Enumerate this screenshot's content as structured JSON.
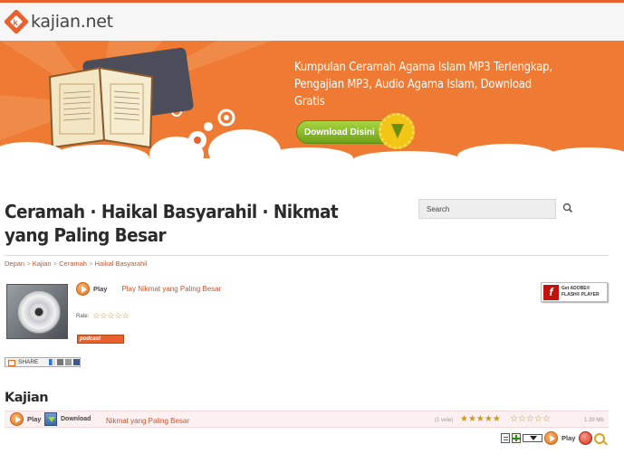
{
  "site": {
    "logo_text": "kajian.net"
  },
  "banner": {
    "tagline": "Kumpulan Ceramah Agama Islam MP3 Terlengkap, Pengajian MP3, Audio Agama Islam, Download Gratis",
    "download_label": "Download Disini",
    "colors": {
      "background": "#ee7a33",
      "button": "#7fb321"
    }
  },
  "page": {
    "title": "Ceramah · Haikal Basyarahil · Nikmat yang Paling Besar"
  },
  "search": {
    "placeholder": "Search"
  },
  "breadcrumb": {
    "items": [
      "Depan",
      "Kajian",
      "Ceramah",
      "Haikal Basyarahil"
    ],
    "separator": ">"
  },
  "player": {
    "play_label": "Play",
    "track_title": "Play Nikmat yang Paling Besar",
    "rate_label": "Rate:",
    "rating_stars": "☆☆☆☆☆",
    "podcast_label": "podcast",
    "flash_badge": {
      "line1": "Get ADOBE®",
      "line2": "FLASH® PLAYER"
    }
  },
  "share": {
    "label": "SHARE"
  },
  "section": {
    "title": "Kajian"
  },
  "track": {
    "play_label": "Play",
    "download_label": "Download",
    "title": "Nikmat yang Paling Besar",
    "votes": "(1 vote)",
    "stars_full": "★★★★★",
    "stars_empty": "☆☆☆☆☆",
    "size": "1.39 Mb"
  },
  "toolbar": {
    "play_label": "Play",
    "icons": [
      "document-icon",
      "add-icon",
      "dropdown-icon",
      "play-icon",
      "stop-icon",
      "search-icon"
    ]
  }
}
